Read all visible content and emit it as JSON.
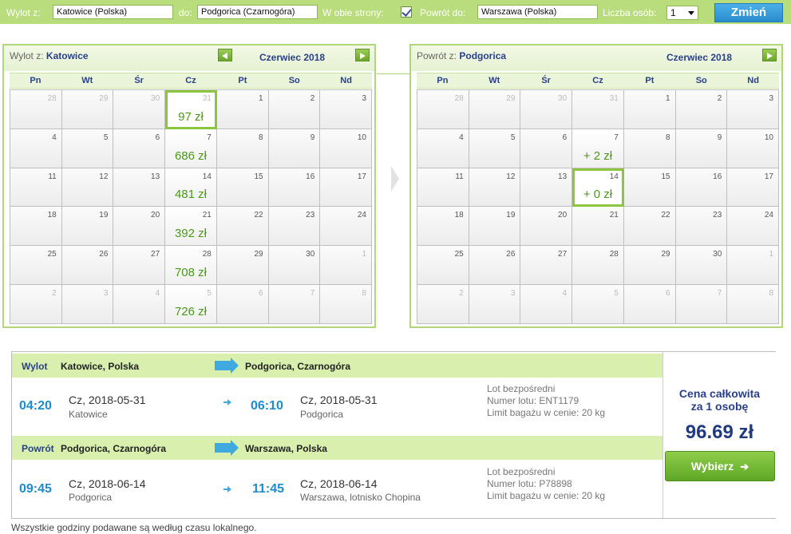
{
  "search": {
    "from_label": "Wylot z:",
    "from_value": "Katowice (Polska)",
    "to_label": "do:",
    "to_value": "Podgorica (Czarnogóra)",
    "roundtrip_label": "W obie strony:",
    "roundtrip_checked": true,
    "return_label": "Powrót do:",
    "return_value": "Warszawa (Polska)",
    "passengers_label": "Liczba osób:",
    "passengers_value": "1",
    "submit_label": "Zmień"
  },
  "day_names": [
    "Pn",
    "Wt",
    "Śr",
    "Cz",
    "Pt",
    "So",
    "Nd"
  ],
  "outbound_calendar": {
    "title_prefix": "Wylot z:",
    "title_city": "Katowice",
    "month": "Czerwiec 2018",
    "days": [
      "28",
      "29",
      "30",
      "31",
      "1",
      "2",
      "3",
      "4",
      "5",
      "6",
      "7",
      "8",
      "9",
      "10",
      "11",
      "12",
      "13",
      "14",
      "15",
      "16",
      "17",
      "18",
      "19",
      "20",
      "21",
      "22",
      "23",
      "24",
      "25",
      "26",
      "27",
      "28",
      "29",
      "30",
      "1",
      "2",
      "3",
      "4",
      "5",
      "6",
      "7",
      "8"
    ],
    "other_month": [
      0,
      1,
      2,
      3,
      34,
      35,
      36,
      37,
      38,
      39,
      40,
      41
    ],
    "prices": {
      "3": "97 zł",
      "10": "686 zł",
      "17": "481 zł",
      "24": "392 zł",
      "31": "708 zł",
      "38": "726 zł"
    },
    "selected": 3
  },
  "return_calendar": {
    "title_prefix": "Powrót z:",
    "title_city": "Podgorica",
    "month": "Czerwiec 2018",
    "days": [
      "28",
      "29",
      "30",
      "31",
      "1",
      "2",
      "3",
      "4",
      "5",
      "6",
      "7",
      "8",
      "9",
      "10",
      "11",
      "12",
      "13",
      "14",
      "15",
      "16",
      "17",
      "18",
      "19",
      "20",
      "21",
      "22",
      "23",
      "24",
      "25",
      "26",
      "27",
      "28",
      "29",
      "30",
      "1",
      "2",
      "3",
      "4",
      "5",
      "6",
      "7",
      "8"
    ],
    "other_month": [
      0,
      1,
      2,
      3,
      34,
      35,
      36,
      37,
      38,
      39,
      40,
      41
    ],
    "prices": {
      "10": "+ 2 zł",
      "17": "+ 0 zł"
    },
    "selected": 17
  },
  "flights": {
    "outbound": {
      "label": "Wylot",
      "from": "Katowice, Polska",
      "to": "Podgorica, Czarnogóra",
      "dep_time": "04:20",
      "dep_date": "Cz, 2018-05-31",
      "dep_city": "Katowice",
      "arr_time": "06:10",
      "arr_date": "Cz, 2018-05-31",
      "arr_city": "Podgorica",
      "info_type": "Lot bezpośredni",
      "info_number": "Numer lotu: ENT1179",
      "info_baggage": "Limit bagażu w cenie: 20 kg"
    },
    "return": {
      "label": "Powrót",
      "from": "Podgorica, Czarnogóra",
      "to": "Warszawa, Polska",
      "dep_time": "09:45",
      "dep_date": "Cz, 2018-06-14",
      "dep_city": "Podgorica",
      "arr_time": "11:45",
      "arr_date": "Cz, 2018-06-14",
      "arr_city": "Warszawa, lotnisko Chopina",
      "info_type": "Lot bezpośredni",
      "info_number": "Numer lotu: P78898",
      "info_baggage": "Limit bagażu w cenie: 20 kg"
    }
  },
  "price": {
    "caption_line1": "Cena całkowita",
    "caption_line2": "za 1 osobę",
    "amount": "96.69 zł",
    "button_label": "Wybierz"
  },
  "footer_note": "Wszystkie godziny podawane są według czasu lokalnego.",
  "colors": {
    "accent_green": "#8cc63f",
    "price_green": "#4a9a18",
    "navy": "#2a3f8a",
    "time_blue": "#1d8ccf"
  },
  "icons": {
    "prev": "arrow-left-icon",
    "next": "arrow-right-icon",
    "flight_arrow": "arrow-right-icon",
    "button_arrow": "arrow-right-icon"
  }
}
